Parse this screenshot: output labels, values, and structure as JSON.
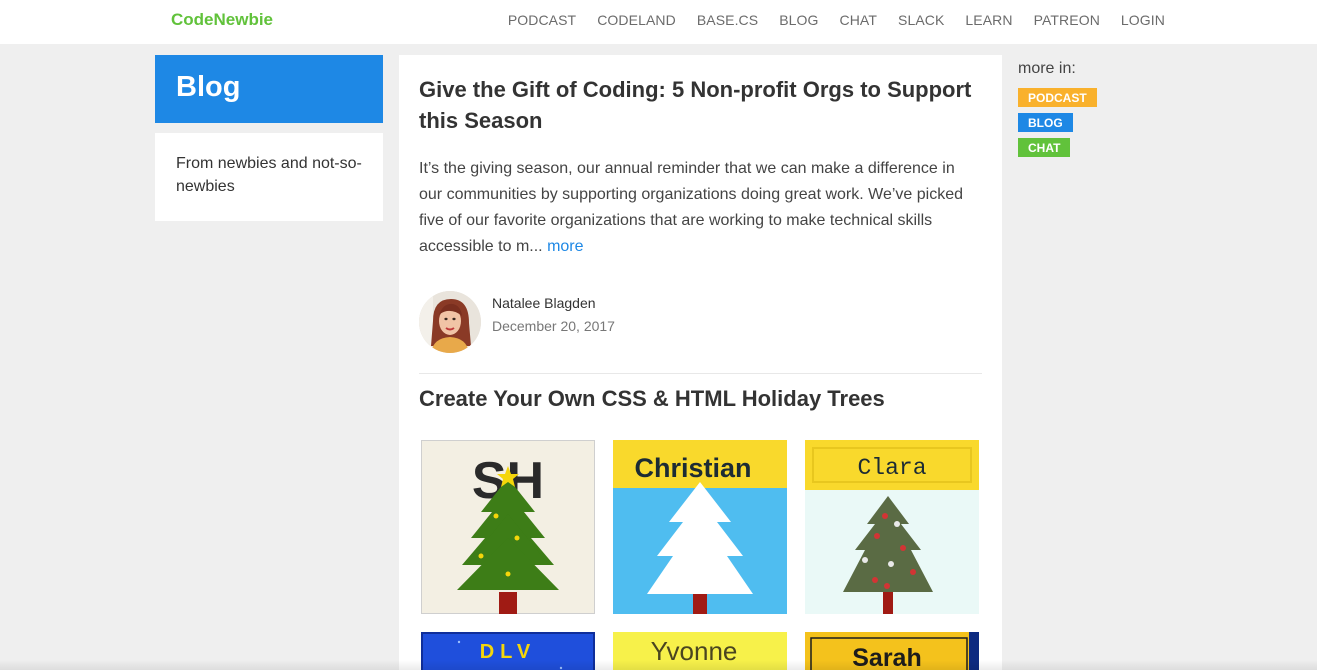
{
  "brand": "CodeNewbie",
  "nav": [
    "PODCAST",
    "CODELAND",
    "BASE.CS",
    "BLOG",
    "CHAT",
    "SLACK",
    "LEARN",
    "PATREON",
    "LOGIN"
  ],
  "sidebar": {
    "title": "Blog",
    "description": "From newbies and not-so-newbies"
  },
  "post1": {
    "title": "Give the Gift of Coding: 5 Non-profit Orgs to Support this Season",
    "excerpt": "It’s the giving season, our annual reminder that we can make a difference in our communities by supporting organizations doing great work. We’ve picked five of our favorite organizations that are working to make technical skills accessible to m...",
    "more_label": "more",
    "author": "Natalee Blagden",
    "date": "December 20, 2017"
  },
  "post2": {
    "title": "Create Your Own CSS & HTML Holiday Trees",
    "tiles": [
      "SH",
      "Christian",
      "Clara",
      "DLV",
      "Yvonne",
      "Sarah"
    ]
  },
  "right": {
    "heading": "more in:",
    "tags": [
      "PODCAST",
      "BLOG",
      "CHAT"
    ]
  },
  "colors": {
    "brand_green": "#61c23b",
    "blog_blue": "#1e88e5",
    "podcast_orange": "#f9b12c"
  }
}
